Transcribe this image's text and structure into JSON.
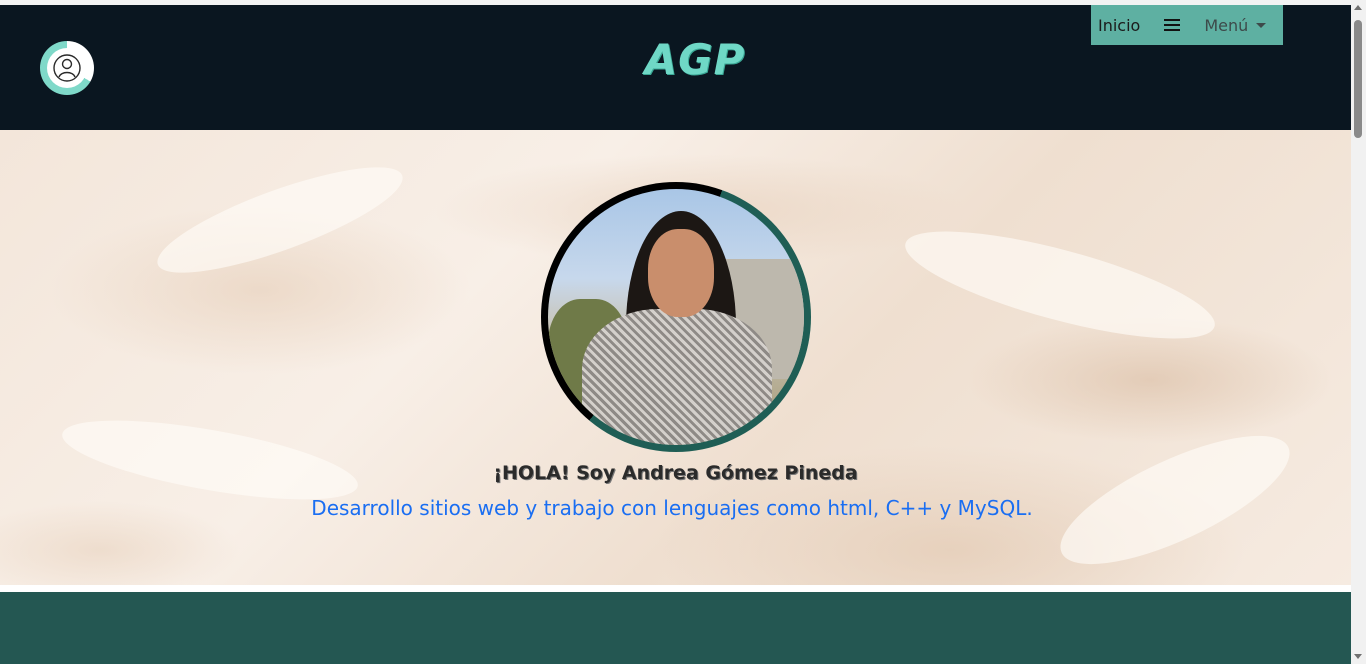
{
  "header": {
    "logo_text": "AGP",
    "nav": {
      "inicio_label": "Inicio",
      "menu_label": "Menú"
    }
  },
  "hero": {
    "greeting": "¡HOLA! Soy Andrea Gómez Pineda",
    "description": "Desarrollo sitios web y trabajo con lenguajes como html, C++ y MySQL."
  },
  "colors": {
    "header_bg": "#0a1620",
    "accent": "#5eb0a2",
    "logo": "#6fd8c6",
    "section_bg": "#245752",
    "link_blue": "#1a6ef2"
  },
  "icons": [
    "user-icon",
    "hamburger-icon",
    "caret-down-icon"
  ]
}
